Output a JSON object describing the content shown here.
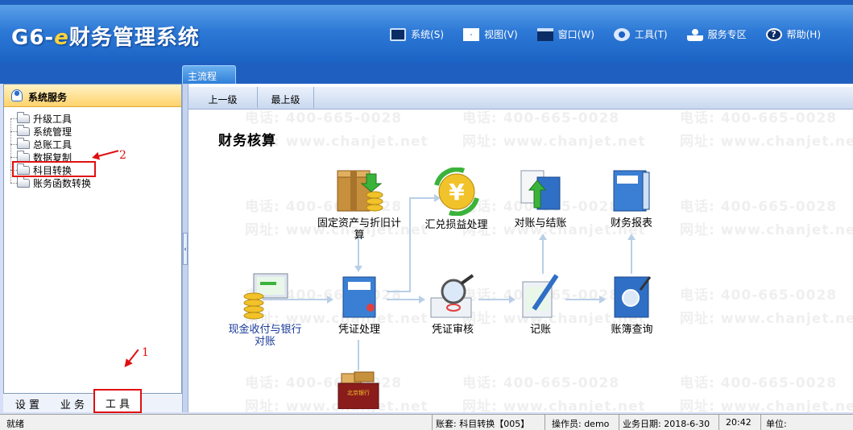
{
  "app": {
    "logo_prefix": "G6-",
    "logo_e": "e",
    "logo_suffix": "财务管理系统"
  },
  "menu": [
    {
      "label": "系统(S)",
      "icon": "monitor-icon"
    },
    {
      "label": "视图(V)",
      "icon": "grid-icon"
    },
    {
      "label": "窗口(W)",
      "icon": "window-icon"
    },
    {
      "label": "工具(T)",
      "icon": "gear-icon"
    },
    {
      "label": "服务专区",
      "icon": "user-icon"
    },
    {
      "label": "帮助(H)",
      "icon": "help-icon"
    }
  ],
  "main_tab": "主流程",
  "sidebar": {
    "header": "系统服务",
    "items": [
      "升级工具",
      "系统管理",
      "总账工具",
      "数据复制",
      "科目转换",
      "账务函数转换"
    ],
    "tabs": [
      "设 置",
      "业 务",
      "工 具"
    ],
    "active_tab": "工 具"
  },
  "annotations": {
    "first": "1",
    "second": "2"
  },
  "toolbar": {
    "up": "上一级",
    "top": "最上级"
  },
  "section_title": "财务核算",
  "watermark": {
    "phone": "电话: 400-665-0028",
    "site": "网址: www.chanjet.net"
  },
  "flow": {
    "fixed_assets": "固定资产与折旧计算",
    "exchange": "汇兑损益处理",
    "reconcile": "对账与结账",
    "reports": "财务报表",
    "cash": "现金收付与银行对账",
    "voucher": "凭证处理",
    "audit": "凭证审核",
    "post": "记账",
    "ledger": "账簿查询",
    "bank_book_badge": "北京银行"
  },
  "statusbar": {
    "ready": "就绪",
    "account": "账套: 科目转换【005】",
    "operator": "操作员: demo",
    "date": "业务日期: 2018-6-30",
    "time": "20:42",
    "unit": "单位:"
  }
}
